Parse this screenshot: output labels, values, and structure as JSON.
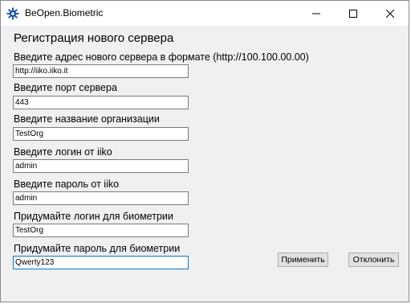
{
  "window": {
    "title": "BeOpen.Biometric"
  },
  "form": {
    "heading": "Регистрация нового сервера",
    "fields": [
      {
        "label": "Введите адрес нового сервера в формате (http://100.100.00.00)",
        "value": "http://iiko.iiko.it"
      },
      {
        "label": "Введите порт сервера",
        "value": "443"
      },
      {
        "label": "Введите название организации",
        "value": "TestOrg"
      },
      {
        "label": "Введите логин от iiko",
        "value": "admin"
      },
      {
        "label": "Введите пароль от iiko",
        "value": "admin"
      },
      {
        "label": "Придумайте логин для биометрии",
        "value": "TestOrg"
      },
      {
        "label": "Придумайте пароль для биометрии",
        "value": "Qwerty123"
      }
    ]
  },
  "buttons": {
    "apply": "Применить",
    "reject": "Отклонить"
  },
  "colors": {
    "window_bg": "#f0f0f0",
    "focus_border": "#0078d7",
    "icon_blue": "#1e5aa8"
  }
}
